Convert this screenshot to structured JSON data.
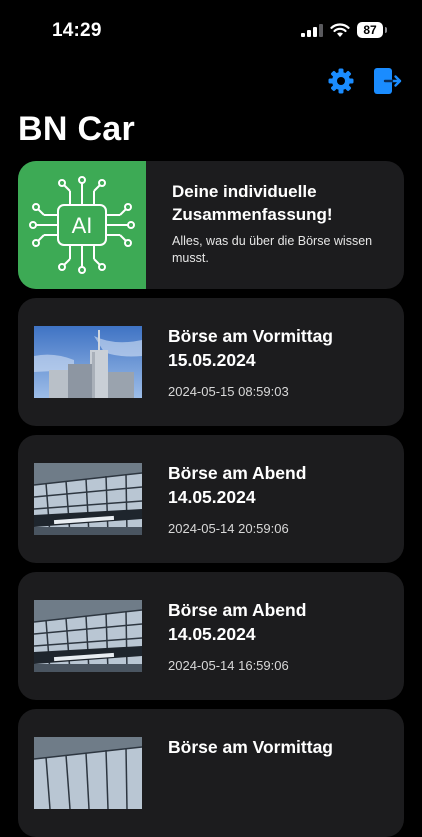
{
  "status": {
    "time": "14:29",
    "battery": "87"
  },
  "header": {
    "title": "BN Car",
    "settings_icon": "gear-icon",
    "logout_icon": "logout-icon",
    "accent_color": "#1a8cff"
  },
  "ai_card": {
    "title": "Deine individuelle Zusammenfassung!",
    "subtitle": "Alles, was du über die Börse wissen musst.",
    "image_label": "AI",
    "image_color": "#3daa55"
  },
  "news": [
    {
      "title": "Börse am Vormittag 15.05.2024",
      "timestamp": "2024-05-15 08:59:03",
      "image": "tower-photo"
    },
    {
      "title": "Börse am Abend 14.05.2024",
      "timestamp": "2024-05-14 20:59:06",
      "image": "building-photo"
    },
    {
      "title": "Börse am Abend 14.05.2024",
      "timestamp": "2024-05-14 16:59:06",
      "image": "building-photo"
    },
    {
      "title": "Börse am Vormittag",
      "timestamp": "",
      "image": "building-photo"
    }
  ]
}
